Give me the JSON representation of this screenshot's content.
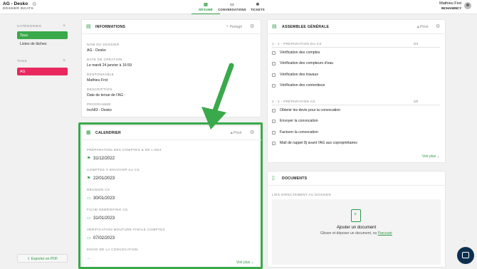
{
  "topbar": {
    "project_name": "AG - Desko",
    "project_subtitle": "DOSSIER INCATS",
    "tabs": [
      {
        "label": "RÉSUMÉ",
        "icon": "summary-icon",
        "active": true
      },
      {
        "label": "CONVERSATIONS",
        "icon": "chat-icon",
        "active": false
      },
      {
        "label": "TICKETS",
        "icon": "ticket-icon",
        "active": false
      }
    ],
    "user_name": "Mathieu Frot",
    "user_org": "INCHAGENCY"
  },
  "sidebar": {
    "categories_label": "CATÉGORIES",
    "categories": [
      {
        "label": "Tous",
        "active": true
      },
      {
        "label": "Listes de tâches",
        "active": false
      }
    ],
    "tags_label": "TAGS",
    "tags": [
      {
        "label": "AG",
        "color": "#e8285e"
      }
    ],
    "export_label": "Exporter en PDF"
  },
  "informations": {
    "title": "INFORMATIONS",
    "share_label": "Partagé",
    "fields": [
      {
        "label": "NOM DU DOSSIER",
        "value": "AG - Desko"
      },
      {
        "label": "DATE DE CRÉATION",
        "value": "Le mardi 24 janvier à 16:59"
      },
      {
        "label": "RESPONSABLE",
        "value": "Mathieu Frot"
      },
      {
        "label": "DESCRIPTION",
        "value": "Date de tenue de l'AG :"
      },
      {
        "label": "PROGRAMME",
        "value": "Inch83 - Desko"
      }
    ]
  },
  "calendrier": {
    "title": "CALENDRIER",
    "private_label": "Privé",
    "events": [
      {
        "label": "PRÉPARATION DES COMPTES & DE L'ODJ",
        "date": "31/12/2022",
        "done": true
      },
      {
        "label": "COMPTES À ENVOYER AU CS",
        "date": "22/01/2023",
        "done": true
      },
      {
        "label": "RÉUNION CS",
        "date": "30/01/2023",
        "done": false
      },
      {
        "label": "FICHE DEBRIEFING CS",
        "date": "31/01/2023",
        "done": false
      },
      {
        "label": "VÉRIFICATION MOUTURE FINALE COMPTES",
        "date": "07/02/2023",
        "done": false
      },
      {
        "label": "ENVOI DE LA CONVOCATION",
        "date": "",
        "done": false
      }
    ],
    "more_label": "Voir plus"
  },
  "assemblee": {
    "title": "ASSEMBLEE GÉNÉRALE",
    "private_label": "Privé",
    "sections": [
      {
        "label": "1 - 1 - PRÉPARATION DU CS",
        "count": "0/4",
        "tasks": [
          "Vérification des comptes",
          "Vérification des compteurs d'eau",
          "Vérification des travaux",
          "Vérification des contentieux"
        ]
      },
      {
        "label": "2 - 2 - PRÉPARATION AG",
        "count": "0/5",
        "tasks": [
          "Obtenir les devis pour la convocation",
          "Envoyer la convocation",
          "Facturer la convocation",
          "Mail de rappel 8j avant l'AG aux copropriétaires"
        ]
      }
    ],
    "more_label": "Voir plus"
  },
  "documents": {
    "title": "DOCUMENTS",
    "linked_label": "LIÉS DIRECTEMENT AU DOSSIER",
    "add_label": "Ajouter un document",
    "drop_label": "Glisser et déposer un document, ou",
    "browse_label": "Parcourir"
  },
  "colors": {
    "accent": "#2e9a44",
    "tag": "#e8285e",
    "chat": "#0d2f4f"
  }
}
